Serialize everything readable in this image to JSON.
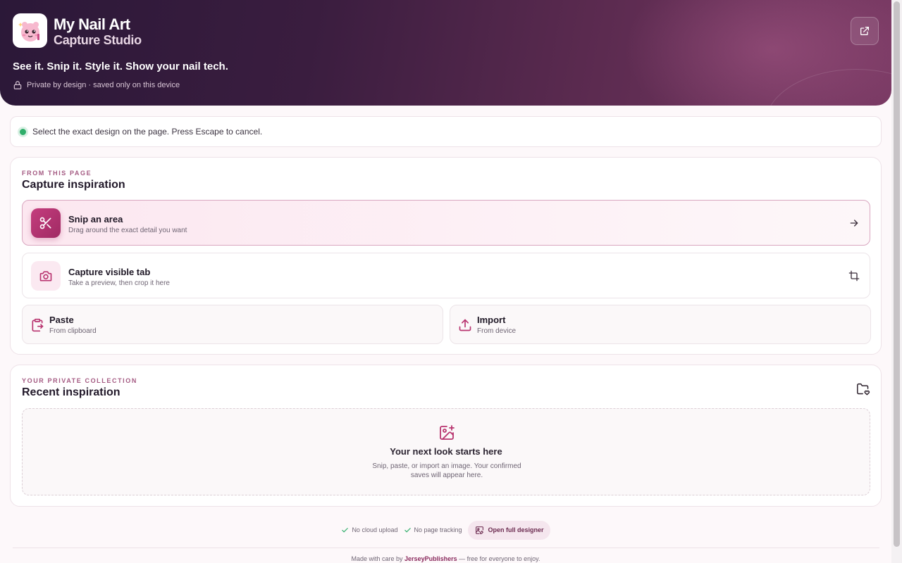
{
  "header": {
    "app_title": "My Nail Art",
    "app_subtitle": "Capture Studio",
    "tagline": "See it. Snip it. Style it. Show your nail tech.",
    "privacy_note": "Private by design · saved only on this device",
    "open_external_icon": "external-link-icon"
  },
  "status": {
    "message": "Select the exact design on the page. Press Escape to cancel.",
    "indicator_color": "#2fae6a"
  },
  "capture": {
    "eyebrow": "FROM THIS PAGE",
    "title": "Capture inspiration",
    "snip": {
      "title": "Snip an area",
      "subtitle": "Drag around the exact detail you want",
      "icon": "scissors-icon",
      "trail_icon": "arrow-right-icon"
    },
    "visible_tab": {
      "title": "Capture visible tab",
      "subtitle": "Take a preview, then crop it here",
      "icon": "camera-icon",
      "trail_icon": "crop-icon"
    },
    "paste": {
      "title": "Paste",
      "subtitle": "From clipboard",
      "icon": "clipboard-icon"
    },
    "import": {
      "title": "Import",
      "subtitle": "From device",
      "icon": "upload-icon"
    }
  },
  "recent": {
    "eyebrow": "YOUR PRIVATE COLLECTION",
    "title": "Recent inspiration",
    "folder_icon": "folder-heart-icon",
    "empty_title": "Your next look starts here",
    "empty_subtitle": "Snip, paste, or import an image. Your confirmed saves will appear here."
  },
  "footer": {
    "badge_no_cloud": "No cloud upload",
    "badge_no_tracking": "No page tracking",
    "designer_button": "Open full designer",
    "credits_prefix": "Made with care by",
    "credits_brand": "JerseyPublishers",
    "credits_suffix": "— free for everyone to enjoy."
  },
  "colors": {
    "accent": "#b8346f",
    "hero_start": "#2b1838",
    "hero_end": "#7a3a64"
  }
}
